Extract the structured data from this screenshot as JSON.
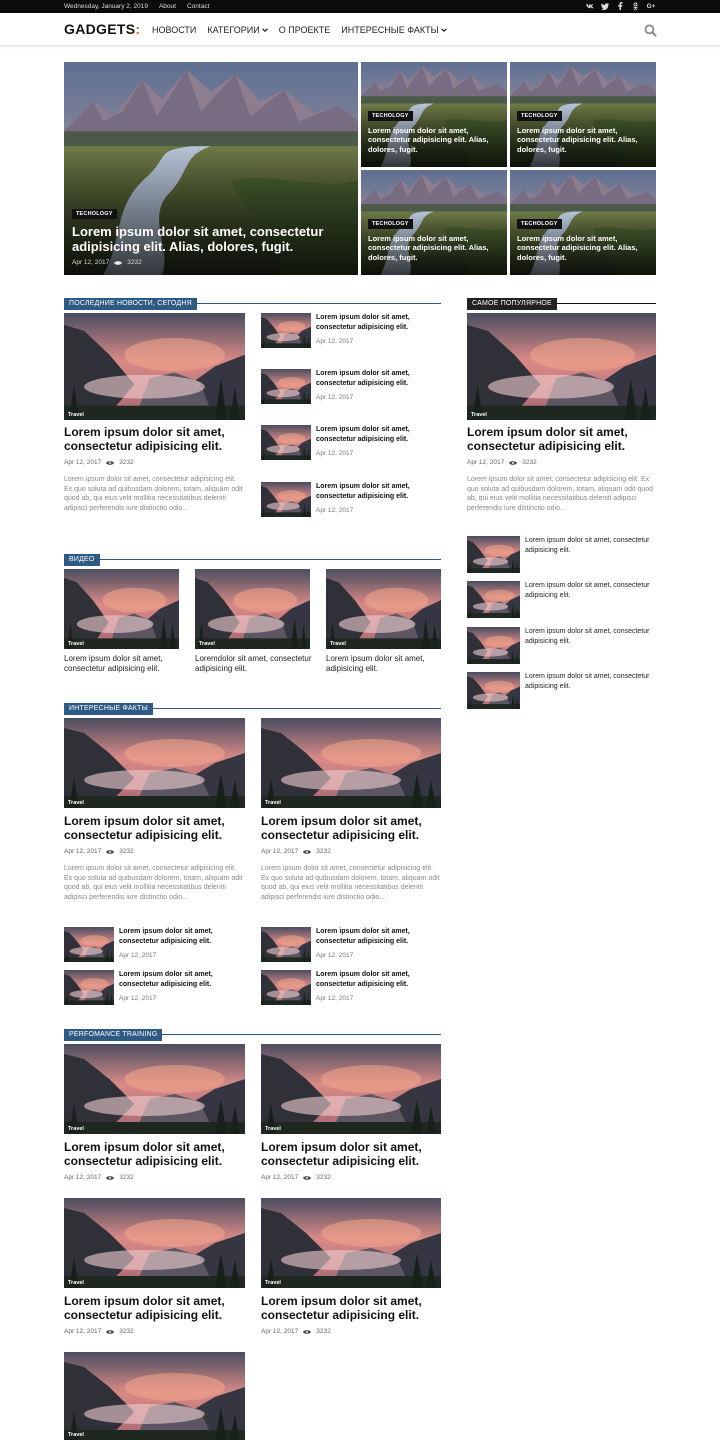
{
  "topbar": {
    "date": "Wednesday, January 2, 2019",
    "links": [
      "About",
      "Contact"
    ],
    "social": [
      {
        "name": "vk-icon",
        "glyph": "vk"
      },
      {
        "name": "twitter-icon",
        "glyph": "t"
      },
      {
        "name": "facebook-icon",
        "glyph": "f"
      },
      {
        "name": "odnoklassniki-icon",
        "glyph": "ok"
      },
      {
        "name": "google-plus-icon",
        "glyph": "G+"
      }
    ]
  },
  "nav": {
    "logo": "GADGETS",
    "logo_mark": ":",
    "items": [
      {
        "label": "НОВОСТИ",
        "dropdown": false
      },
      {
        "label": "КАТЕГОРИИ",
        "dropdown": true
      },
      {
        "label": "О ПРОЕКТЕ",
        "dropdown": false
      },
      {
        "label": "ИНТЕРЕСНЫЕ ФАКТЫ",
        "dropdown": true
      }
    ]
  },
  "hero": {
    "main": {
      "tag": "TECHOLOGY",
      "title": "Lorem ipsum dolor sit amet, consectetur adipisicing elit. Alias, dolores, fugit.",
      "date": "Apr 12, 2017",
      "views": "3232"
    },
    "small": [
      {
        "tag": "TECHOLOGY",
        "title": "Lorem ipsum dolor sit amet, consectetur adipisicing elit. Alias, dolores, fugit."
      },
      {
        "tag": "TECHOLOGY",
        "title": "Lorem ipsum dolor sit amet, consectetur adipisicing elit. Alias, dolores, fugit."
      },
      {
        "tag": "TECHOLOGY",
        "title": "Lorem ipsum dolor sit amet, consectetur adipisicing elit. Alias, dolores, fugit."
      },
      {
        "tag": "TECHOLOGY",
        "title": "Lorem ipsum dolor sit amet, consectetur adipisicing elit. Alias, dolores, fugit."
      }
    ]
  },
  "latest": {
    "heading": "ПОСЛЕДНИЕ НОВОСТИ, СЕГОДНЯ",
    "feature": {
      "cat": "Travel",
      "title": "Lorem ipsum dolor sit amet, consectetur adipisicing elit.",
      "date": "Apr 12, 2017",
      "views": "3232",
      "excerpt": "Lorem ipsum dolor sit amet, consectetur adipisicing elit. Ex quo soluta ad quibusdam dolorem, totam, aliquam odit quod ab, qui eius velit mollitia necessitatibus deleniti adipisci perferendis iure distinctio odio..."
    },
    "list": [
      {
        "title": "Lorem ipsum dolor sit amet, consectetur adipisicing elit.",
        "date": "Apr 12, 2017"
      },
      {
        "title": "Lorem ipsum dolor sit amet, consectetur adipisicing elit.",
        "date": "Apr 12, 2017"
      },
      {
        "title": "Lorem ipsum dolor sit amet, consectetur adipisicing elit.",
        "date": "Apr 12, 2017"
      },
      {
        "title": "Lorem ipsum dolor sit amet, consectetur adipisicing elit.",
        "date": "Apr 12, 2017"
      }
    ]
  },
  "video": {
    "heading": "ВИДЕО",
    "items": [
      {
        "cat": "Travel",
        "title": "Lorem ipsum dolor sit amet, consectetur adipisicing elit."
      },
      {
        "cat": "Travel",
        "title": "Loremdolor sit amet, consectetur adipisicing elit."
      },
      {
        "cat": "Travel",
        "title": "Lorem ipsum dolor sit amet, adipisicing elit."
      }
    ]
  },
  "facts": {
    "heading": "ИНТЕРЕСНЫЕ ФАКТЫ",
    "columns": [
      {
        "feature": {
          "cat": "Travel",
          "title": "Lorem ipsum dolor sit amet, consectetur adipisicing elit.",
          "date": "Apr 12, 2017",
          "views": "3232",
          "excerpt": "Lorem ipsum dolor sit amet, consectetur adipisicing elit. Ex quo soluta ad quibusdam dolorem, totam, aliquam odit quod ab, qui eius velit mollitia necessitatibus deleniti adipisci perferendis iure distinctio odio..."
        },
        "list": [
          {
            "title": "Lorem ipsum dolor sit amet, consectetur adipisicing elit.",
            "date": "Apr 12, 2017"
          },
          {
            "title": "Lorem ipsum dolor sit amet, consectetur adipisicing elit.",
            "date": "Apr 12, 2017"
          }
        ]
      },
      {
        "feature": {
          "cat": "Travel",
          "title": "Lorem ipsum dolor sit amet, consectetur adipisicing elit.",
          "date": "Apr 12, 2017",
          "views": "3232",
          "excerpt": "Lorem ipsum dolor sit amet, consectetur adipisicing elit. Ex quo soluta ad quibusdam dolorem, totam, aliquam odit quod ab, qui eius velit mollitia necessitatibus deleniti adipisci perferendis iure distinctio odio..."
        },
        "list": [
          {
            "title": "Lorem ipsum dolor sit amet, consectetur adipisicing elit.",
            "date": "Apr 12, 2017"
          },
          {
            "title": "Lorem ipsum dolor sit amet, consectetur adipisicing elit.",
            "date": "Apr 12, 2017"
          }
        ]
      }
    ]
  },
  "perf": {
    "heading": "PERFOMANCE TRAINING",
    "items": [
      {
        "cat": "Travel",
        "title": "Lorem ipsum dolor sit amet, consectetur adipisicing elit.",
        "date": "Apr 12, 2017",
        "views": "3232"
      },
      {
        "cat": "Travel",
        "title": "Lorem ipsum dolor sit amet, consectetur adipisicing elit.",
        "date": "Apr 12, 2017",
        "views": "3232"
      },
      {
        "cat": "Travel",
        "title": "Lorem ipsum dolor sit amet, consectetur adipisicing elit.",
        "date": "Apr 12, 2017",
        "views": "3232"
      },
      {
        "cat": "Travel",
        "title": "Lorem ipsum dolor sit amet, consectetur adipisicing elit.",
        "date": "Apr 12, 2017",
        "views": "3232"
      },
      {
        "cat": "Travel"
      }
    ]
  },
  "popular": {
    "heading": "САМОЕ ПОПУЛЯРНОЕ",
    "feature": {
      "cat": "Travel",
      "title": "Lorem ipsum dolor sit amet, consectetur adipisicing elit.",
      "date": "Apr 12, 2017",
      "views": "3232",
      "excerpt": "Lorem ipsum dolor sit amet, consectetur adipisicing elit. Ex quo soluta ad quibusdam dolorem, totam, aliquam odit quod ab, qui eius velit mollitia necessitatibus deleniti adipisci perferendis iure distinctio odio..."
    },
    "list": [
      {
        "title": "Lorem ipsum dolor sit amet, consectetur adipisicing elit."
      },
      {
        "title": "Lorem ipsum dolor sit amet, consectetur adipisicing elit."
      },
      {
        "title": "Lorem ipsum dolor sit amet, consectetur adipisicing elit."
      },
      {
        "title": "Lorem ipsum dolor sit amet, consectetur adipisicing elit."
      }
    ]
  },
  "colors": {
    "accent": "#2e5a83",
    "logo_accent": "#e05a1c",
    "topbar": "#0b0b0b"
  }
}
